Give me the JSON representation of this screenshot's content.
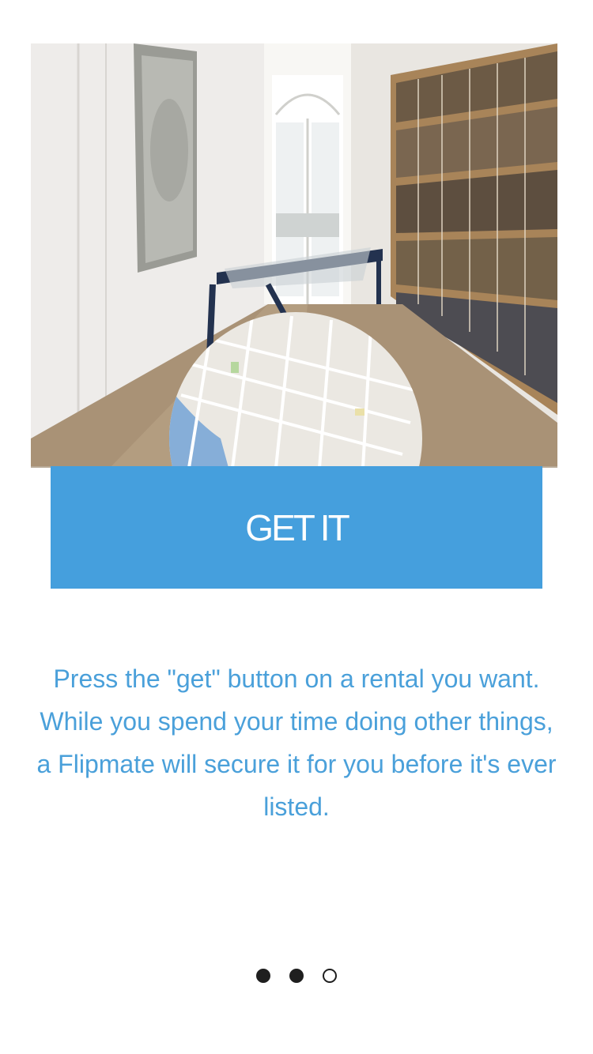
{
  "hero": {
    "image_label": "Hallway with bookshelves and a circular map overlay",
    "map_icon": "map-circle"
  },
  "cta": {
    "label": "GET IT",
    "color": "#459fdd"
  },
  "description": {
    "text": "Press the \"get\" button on a rental you want. While you spend your time doing other things, a Flipmate will secure it for you before it's ever listed.",
    "color": "#4aa0da"
  },
  "pagination": {
    "pages": 3,
    "active": [
      1,
      2
    ]
  }
}
